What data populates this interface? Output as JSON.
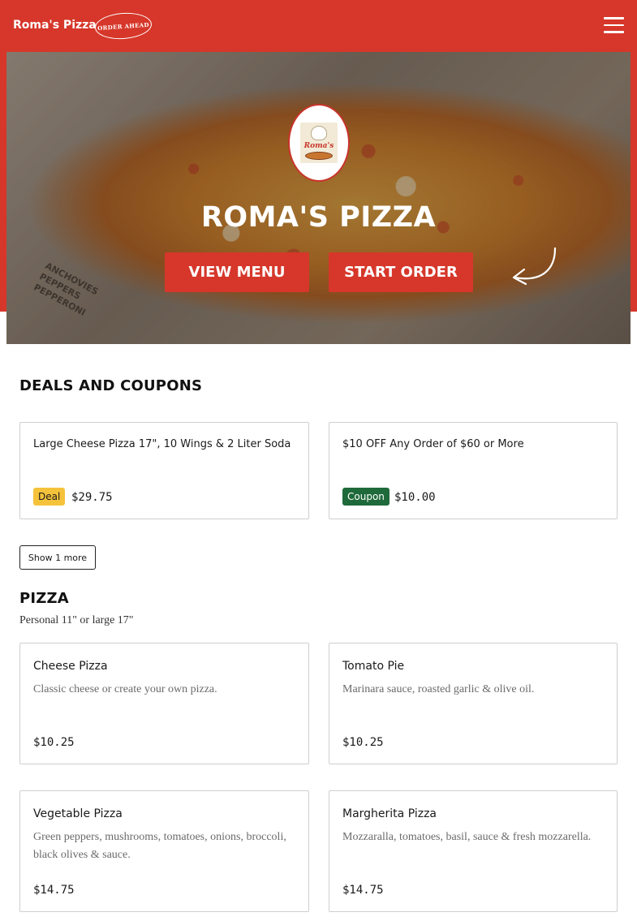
{
  "header": {
    "brand": "Roma's Pizza",
    "order_ahead_logo": "ORDER AHEAD",
    "menu_icon": "hamburger-icon"
  },
  "hero": {
    "logo_text": "Roma's",
    "box_text": [
      "ANCHOVIES",
      "PEPPERS",
      "PEPPERONI"
    ],
    "title": "ROMA'S PIZZA",
    "view_menu": "VIEW MENU",
    "start_order": "START ORDER",
    "arrow_icon": "curved-arrow-icon"
  },
  "deals": {
    "title": "DEALS AND COUPONS",
    "items": [
      {
        "name": "Large Cheese Pizza 17\", 10 Wings & 2 Liter Soda",
        "badge": "Deal",
        "price": "$29.75"
      },
      {
        "name": "$10 OFF Any Order of $60 or More",
        "badge": "Coupon",
        "price": "$10.00"
      }
    ],
    "show_more": "Show 1 more"
  },
  "pizza": {
    "title": "PIZZA",
    "subtitle": "Personal 11\" or large 17\"",
    "items": [
      {
        "name": "Cheese Pizza",
        "desc": "Classic cheese or create your own pizza.",
        "price": "$10.25"
      },
      {
        "name": "Tomato Pie",
        "desc": "Marinara sauce, roasted garlic & olive oil.",
        "price": "$10.25"
      },
      {
        "name": "Vegetable Pizza",
        "desc": "Green peppers, mushrooms, tomatoes, onions, broccoli, black olives & sauce.",
        "price": "$14.75"
      },
      {
        "name": "Margherita Pizza",
        "desc": "Mozzaralla, tomatoes, basil, sauce & fresh mozzarella.",
        "price": "$14.75"
      }
    ]
  },
  "colors": {
    "brand_red": "#d6372a",
    "deal_yellow": "#f5c23b",
    "coupon_green": "#1f6a3a"
  }
}
